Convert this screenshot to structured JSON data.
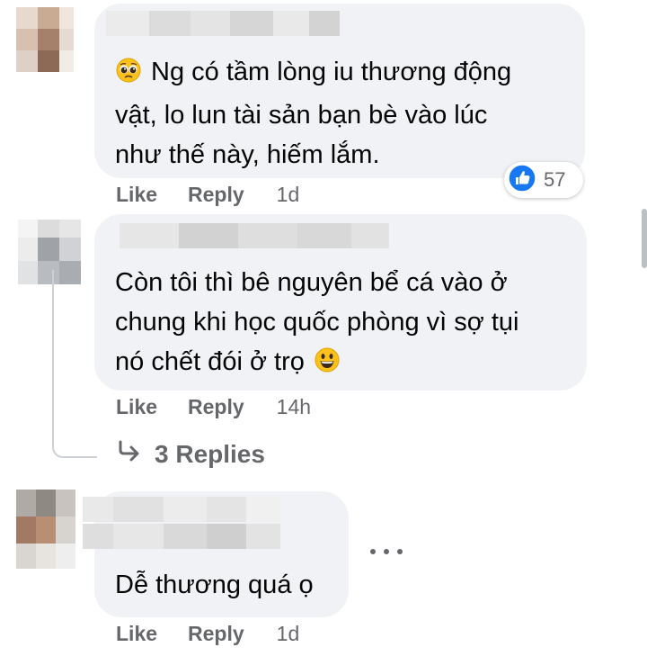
{
  "comments": [
    {
      "text": "Ng có tầm lòng iu thương động\nvật, lo lun tài sản bạn bè vào lúc\nnhư thế này, hiếm lắm.",
      "emoji": "pleading-face-icon",
      "like_label": "Like",
      "reply_label": "Reply",
      "time": "1d",
      "reaction": {
        "type": "like-icon",
        "count": "57"
      }
    },
    {
      "text": "Còn tôi thì bê nguyên bể cá vào ở\nchung khi học quốc phòng vì sợ tụi\nnó chết đói ở trọ",
      "emoji": "grinning-face-icon",
      "like_label": "Like",
      "reply_label": "Reply",
      "time": "14h",
      "replies_label": "3 Replies"
    },
    {
      "text": "Dễ thương quá ọ",
      "like_label": "Like",
      "reply_label": "Reply",
      "time": "1d"
    }
  ],
  "colors": {
    "bubble": "#f0f2f5",
    "text": "#050505",
    "secondary": "#65676b",
    "like_blue": "#1877f2"
  }
}
